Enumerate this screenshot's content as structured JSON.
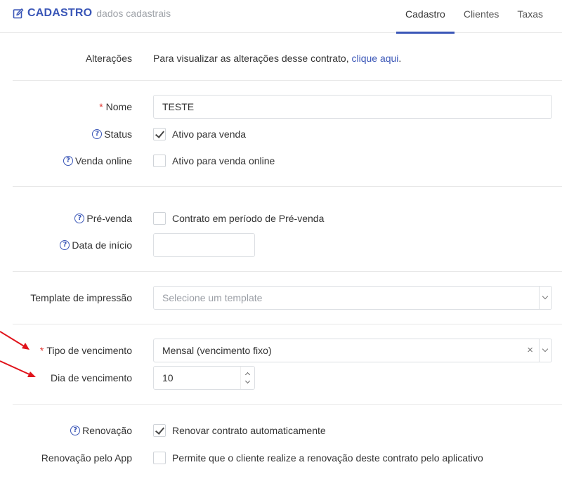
{
  "header": {
    "title": "CADASTRO",
    "subtitle": "dados cadastrais",
    "tabs": [
      {
        "label": "Cadastro",
        "active": true
      },
      {
        "label": "Clientes",
        "active": false
      },
      {
        "label": "Taxas",
        "active": false
      }
    ]
  },
  "form": {
    "alteracoes": {
      "label": "Alterações",
      "text": "Para visualizar as alterações desse contrato, ",
      "link": "clique aqui",
      "suffix": "."
    },
    "nome": {
      "label": "Nome",
      "required_mark": "*",
      "value": "TESTE"
    },
    "status": {
      "label": "Status",
      "option": "Ativo para venda",
      "checked": true
    },
    "venda_online": {
      "label": "Venda online",
      "option": "Ativo para venda online",
      "checked": false
    },
    "pre_venda": {
      "label": "Pré-venda",
      "option": "Contrato em período de Pré-venda",
      "checked": false
    },
    "data_inicio": {
      "label": "Data de início",
      "value": ""
    },
    "template": {
      "label": "Template de impressão",
      "placeholder": "Selecione um template"
    },
    "tipo_vencimento": {
      "label": "Tipo de vencimento",
      "required_mark": "*",
      "value": "Mensal (vencimento fixo)",
      "clear": "×"
    },
    "dia_vencimento": {
      "label": "Dia de vencimento",
      "value": "10"
    },
    "renovacao": {
      "label": "Renovação",
      "option": "Renovar contrato automaticamente",
      "checked": true
    },
    "renovacao_app": {
      "label": "Renovação pelo App",
      "option": "Permite que o cliente realize a renovação deste contrato pelo aplicativo",
      "checked": false
    }
  },
  "help_glyph": "?",
  "colors": {
    "accent": "#3a56b7",
    "required": "#e0312b",
    "annotation_arrow": "#e0131b"
  }
}
